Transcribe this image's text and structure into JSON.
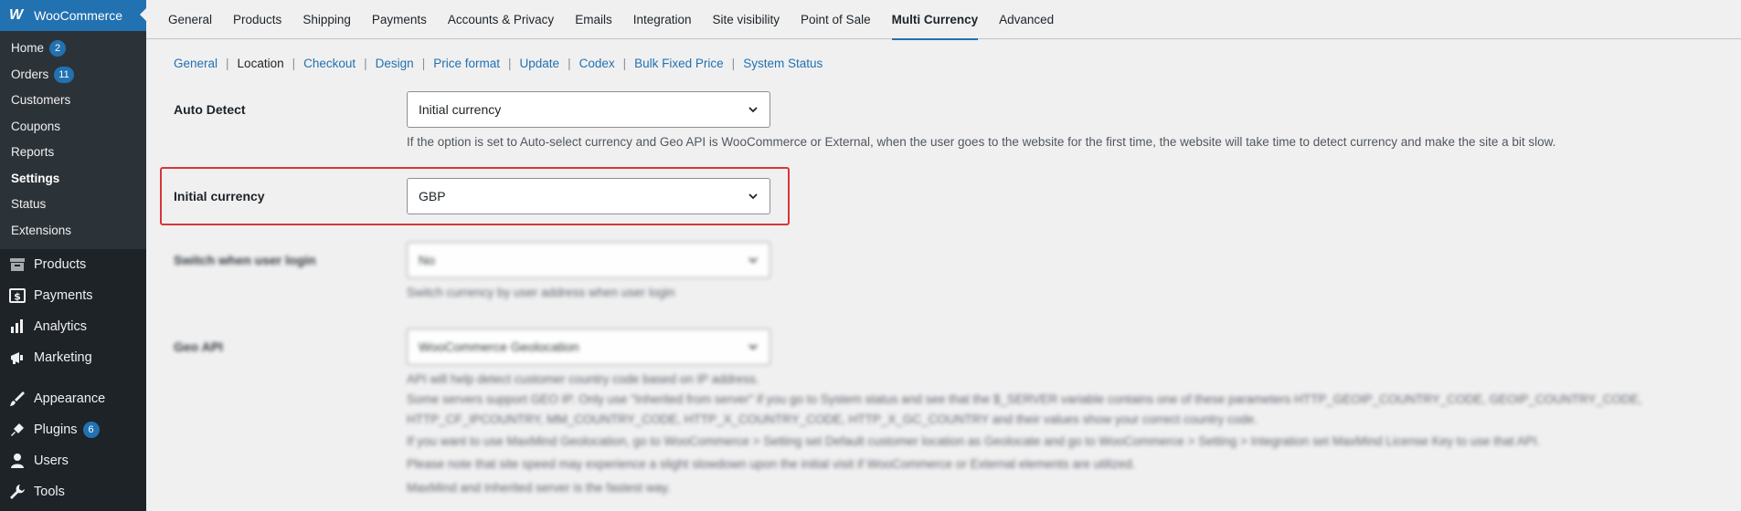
{
  "sidebar": {
    "brand": "WooCommerce",
    "brand_logo": "W",
    "submenu": [
      {
        "label": "Home",
        "badge": "2"
      },
      {
        "label": "Orders",
        "badge": "11"
      },
      {
        "label": "Customers"
      },
      {
        "label": "Coupons"
      },
      {
        "label": "Reports"
      },
      {
        "label": "Settings",
        "current": true
      },
      {
        "label": "Status"
      },
      {
        "label": "Extensions"
      }
    ],
    "menu": [
      {
        "label": "Products",
        "icon": "archive-icon"
      },
      {
        "label": "Payments",
        "icon": "dollar-icon"
      },
      {
        "label": "Analytics",
        "icon": "bar-chart-icon"
      },
      {
        "label": "Marketing",
        "icon": "megaphone-icon"
      },
      {
        "label": "Appearance",
        "icon": "brush-icon"
      },
      {
        "label": "Plugins",
        "icon": "plug-icon",
        "badge": "6"
      },
      {
        "label": "Users",
        "icon": "user-icon"
      },
      {
        "label": "Tools",
        "icon": "wrench-icon"
      }
    ]
  },
  "tabs": [
    {
      "label": "General"
    },
    {
      "label": "Products"
    },
    {
      "label": "Shipping"
    },
    {
      "label": "Payments"
    },
    {
      "label": "Accounts & Privacy"
    },
    {
      "label": "Emails"
    },
    {
      "label": "Integration"
    },
    {
      "label": "Site visibility"
    },
    {
      "label": "Point of Sale"
    },
    {
      "label": "Multi Currency",
      "active": true
    },
    {
      "label": "Advanced"
    }
  ],
  "subnav": [
    {
      "label": "General"
    },
    {
      "label": "Location",
      "current": true
    },
    {
      "label": "Checkout"
    },
    {
      "label": "Design"
    },
    {
      "label": "Price format"
    },
    {
      "label": "Update"
    },
    {
      "label": "Codex"
    },
    {
      "label": "Bulk Fixed Price"
    },
    {
      "label": "System Status"
    }
  ],
  "form": {
    "auto_detect": {
      "label": "Auto Detect",
      "value": "Initial currency",
      "description": "If the option is set to Auto-select currency and Geo API is WooCommerce or External, when the user goes to the website for the first time, the website will take time to detect currency and make the site a bit slow."
    },
    "initial_currency": {
      "label": "Initial currency",
      "value": "GBP"
    },
    "switch_login": {
      "label": "Switch when user login",
      "value": "No",
      "description": "Switch currency by user address when user login"
    },
    "geo_api": {
      "label": "Geo API",
      "value": "WooCommerce Geolocation",
      "descriptions": [
        "API will help detect customer country code based on IP address.",
        "Some servers support GEO IP. Only use \"Inherited from server\" if you go to System status and see that the $_SERVER variable contains one of these parameters HTTP_GEOIP_COUNTRY_CODE, GEOIP_COUNTRY_CODE,",
        "HTTP_CF_IPCOUNTRY, MM_COUNTRY_CODE, HTTP_X_COUNTRY_CODE, HTTP_X_GC_COUNTRY and their values show your correct country code.",
        "If you want to use MaxMind Geolocation, go to WooCommerce > Setting set Default customer location as Geolocate and go to WooCommerce > Setting > Integration set MaxMind License Key to use that API.",
        "Please note that site speed may experience a slight slowdown upon the initial visit if WooCommerce or External elements are utilized.",
        "MaxMind and Inherited server is the fastest way."
      ]
    }
  },
  "colors": {
    "accent": "#2271b1",
    "sidebar_bg": "#1d2327",
    "highlight": "#d63638"
  }
}
